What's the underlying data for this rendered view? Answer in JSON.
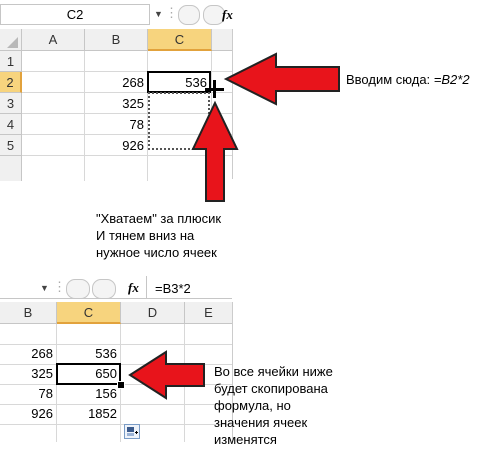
{
  "top_sheet": {
    "name_box": "C2",
    "fx_label": "fx",
    "col_headers": [
      "A",
      "B",
      "C"
    ],
    "row_headers": [
      "1",
      "2",
      "3",
      "4",
      "5"
    ],
    "values_b": [
      "268",
      "325",
      "78",
      "926"
    ],
    "value_c2": "536"
  },
  "annotation_top": {
    "text": "Вводим сюда:",
    "formula": "=B2*2"
  },
  "annotation_middle": {
    "line1": "\"Хватаем\" за плюсик",
    "line2": "И тянем вниз на",
    "line3": "нужное число ячеек"
  },
  "bottom_sheet": {
    "fx_label": "fx",
    "formula": "=B3*2",
    "col_headers": [
      "B",
      "C",
      "D",
      "E"
    ],
    "values_b": [
      "268",
      "325",
      "78",
      "926"
    ],
    "values_c": [
      "536",
      "650",
      "156",
      "1852"
    ]
  },
  "annotation_bottom": {
    "line1": "Во все ячейки ниже",
    "line2": "будет скопирована",
    "line3": "формула, но",
    "line4": "значения ячеек",
    "line5": "изменятся"
  },
  "colors": {
    "arrow_fill": "#e8141b",
    "header_bg": "#f0f0f0",
    "selected_header_bg": "#f7d47e"
  }
}
